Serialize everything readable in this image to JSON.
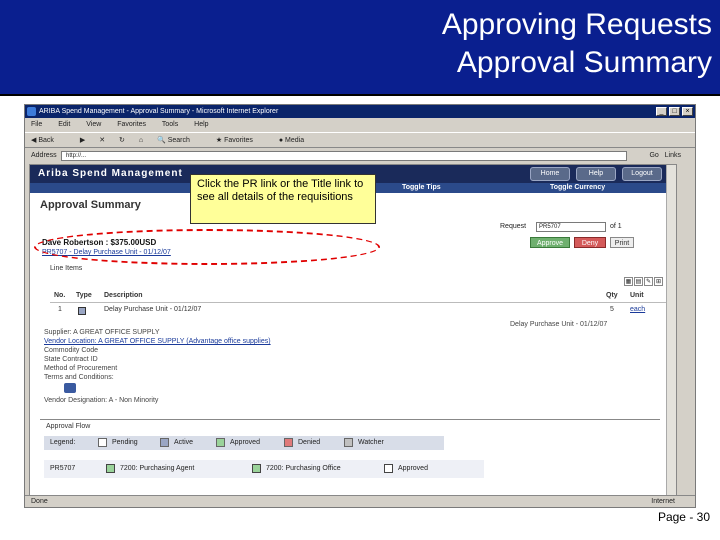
{
  "slide": {
    "title_line1": "Approving Requests",
    "title_line2": "Approval Summary",
    "page_number": "Page - 30",
    "callout": "Click the PR link or the Title link to see all details of the requisitions"
  },
  "browser": {
    "window_title": "ARIBA Spend Management - Approval Summary - Microsoft Internet Explorer",
    "menu": [
      "File",
      "Edit",
      "View",
      "Favorites",
      "Tools",
      "Help"
    ],
    "toolbar": [
      "Back",
      "Search",
      "Favorites",
      "Media"
    ],
    "address_label": "Address",
    "address_value": "http://...",
    "go_label": "Go",
    "links_label": "Links",
    "status_done": "Done",
    "status_zone": "Internet"
  },
  "app": {
    "brand": "Ariba Spend Management",
    "buttons": {
      "home": "Home",
      "help": "Help",
      "logout": "Logout"
    },
    "toggle_tips": "Toggle Tips",
    "toggle_currency": "Toggle Currency",
    "page_title": "Approval Summary",
    "request_label": "Request",
    "request_value": "PR5707",
    "request_of": "of 1",
    "approve": "Approve",
    "deny": "Deny",
    "print": "Print",
    "requester": "Dave Robertson : $375.00USD",
    "line_items_label": "Line Items",
    "table_headers": {
      "no": "No.",
      "type": "Type",
      "description": "Description",
      "qty": "Qty",
      "unit": "Unit"
    },
    "row": {
      "no": "1",
      "description": "Delay Purchase Unit - 01/12/07",
      "qty": "5",
      "unit": "each"
    },
    "details": {
      "supplier": "Supplier: A GREAT OFFICE SUPPLY",
      "vendor_location": "Vendor Location: A GREAT OFFICE SUPPLY (Advantage office supplies)",
      "commodity_code": "Commodity Code",
      "state_contract": "State Contract ID",
      "method": "Method of Procurement",
      "terms": "Terms and Conditions:",
      "vendor_designation": "Vendor Designation: A - Non Minority"
    },
    "sub_description": "Delay Purchase Unit - 01/12/07",
    "approval_flow_title": "Approval Flow",
    "legend": {
      "label": "Legend:",
      "pending": "Pending",
      "active": "Active",
      "approved": "Approved",
      "denied": "Denied",
      "watcher": "Watcher"
    },
    "flow": {
      "pr": "PR5707",
      "step1": "7200: Purchasing Agent",
      "step2": "7200: Purchasing Office",
      "status": "Approved"
    }
  }
}
